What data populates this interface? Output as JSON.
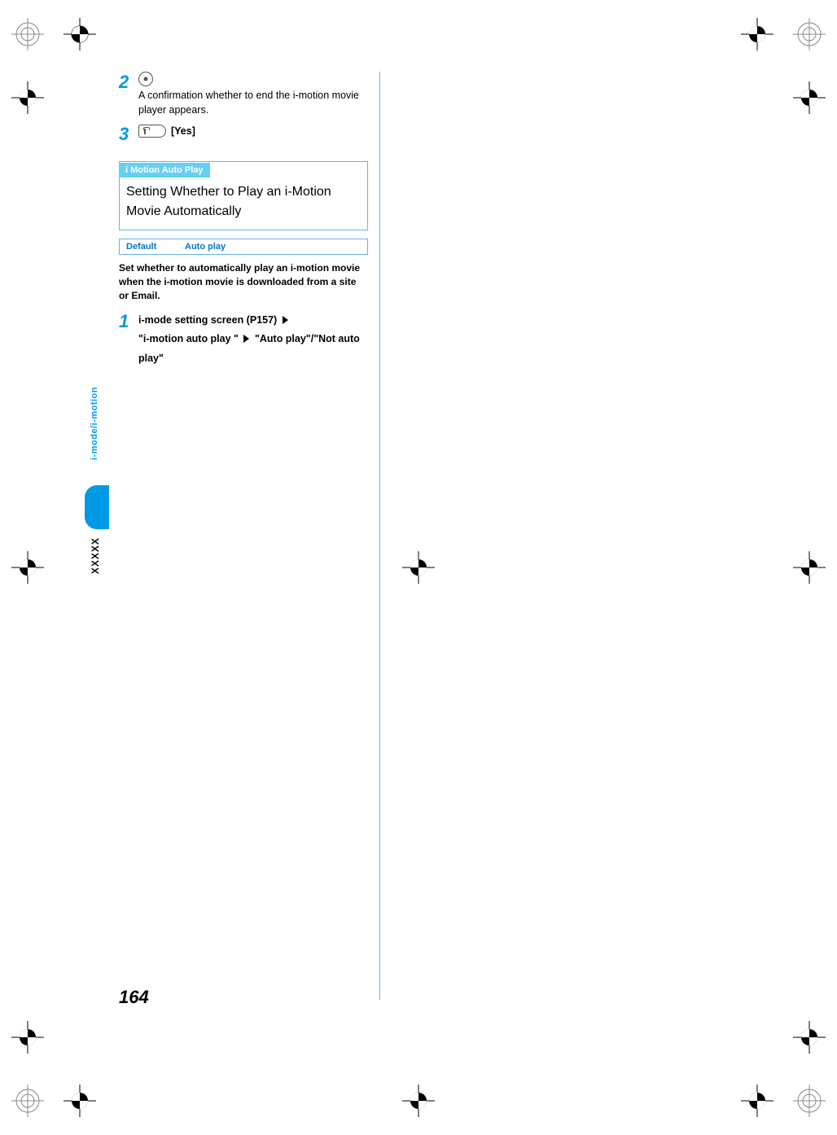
{
  "page_number": "164",
  "side_tab": "i-mode/i-motion",
  "side_placeholder": "XXXXX",
  "steps_top": [
    {
      "num": "2",
      "icon": "nav-dot",
      "desc": "A confirmation whether to end the i-motion movie player appears."
    },
    {
      "num": "3",
      "icon": "softkey",
      "bracket": "[Yes]"
    }
  ],
  "section": {
    "tag": "i Motion Auto Play",
    "title": "Setting Whether to Play an i-Motion Movie Automatically"
  },
  "default_row": {
    "label": "Default",
    "value": "Auto play"
  },
  "intro": "Set whether to automatically play an i-motion movie when the i-motion movie is downloaded from a site or Email.",
  "sub_step": {
    "num": "1",
    "line1_a": "i-mode setting screen (P157)",
    "line2_a": "\"i-motion auto play \"",
    "line2_b": "\"Auto play\"/\"Not auto play\""
  }
}
